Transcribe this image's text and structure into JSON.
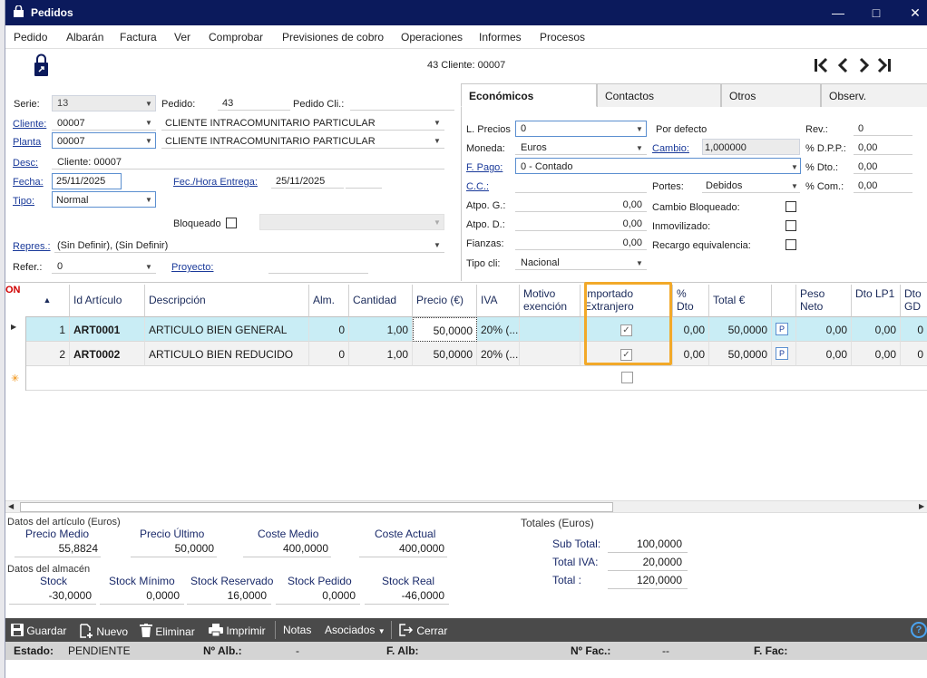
{
  "window": {
    "title": "Pedidos"
  },
  "menu": [
    "Pedido",
    "Albarán",
    "Factura",
    "Ver",
    "Comprobar",
    "Previsiones de cobro",
    "Operaciones",
    "Informes",
    "Procesos"
  ],
  "header": {
    "record_label": "43 Cliente: 00007"
  },
  "form": {
    "serie_label": "Serie:",
    "serie_value": "13",
    "pedido_label": "Pedido:",
    "pedido_value": "43",
    "pedido_cli_label": "Pedido Cli.:",
    "cliente_label": "Cliente:",
    "cliente_code": "00007",
    "cliente_name": "CLIENTE INTRACOMUNITARIO PARTICULAR",
    "planta_label": "Planta",
    "planta_code": "00007",
    "planta_name": "CLIENTE INTRACOMUNITARIO PARTICULAR",
    "desc_label": "Desc:",
    "desc_value": "Cliente: 00007",
    "fecha_label": "Fecha:",
    "fecha_value": "25/11/2025",
    "fec_entrega_label": "Fec./Hora Entrega:",
    "fec_entrega_value": "25/11/2025",
    "tipo_label": "Tipo:",
    "tipo_value": "Normal",
    "bloqueado_label": "Bloqueado",
    "repres_label": "Repres.:",
    "repres_value": "(Sin Definir), (Sin Definir)",
    "refer_label": "Refer.:",
    "refer_value": "0",
    "proyecto_label": "Proyecto:"
  },
  "tabs": [
    "Económicos",
    "Contactos",
    "Otros",
    "Observ."
  ],
  "econ": {
    "lprecios_label": "L. Precios",
    "lprecios_value": "0",
    "por_defecto": "Por defecto",
    "rev_label": "Rev.:",
    "rev_value": "0",
    "moneda_label": "Moneda:",
    "moneda_value": "Euros",
    "cambio_label": "Cambio:",
    "cambio_value": "1,000000",
    "dpp_label": "% D.P.P.:",
    "dpp_value": "0,00",
    "fpago_label": "F. Pago:",
    "fpago_value": "0 - Contado",
    "dto_label": "% Dto.:",
    "dto_value": "0,00",
    "cc_label": "C.C.:",
    "portes_label": "Portes:",
    "portes_value": "Debidos",
    "com_label": "% Com.:",
    "com_value": "0,00",
    "atpog_label": "Atpo. G.:",
    "atpog_value": "0,00",
    "cambio_bloq_label": "Cambio Bloqueado:",
    "atpod_label": "Atpo. D.:",
    "atpod_value": "0,00",
    "inmov_label": "Inmovilizado:",
    "fianzas_label": "Fianzas:",
    "fianzas_value": "0,00",
    "recargo_label": "Recargo equivalencia:",
    "tipocli_label": "Tipo cli:",
    "tipocli_value": "Nacional"
  },
  "grid": {
    "on_label": "ON",
    "columns": [
      "Id Artículo",
      "Descripción",
      "Alm.",
      "Cantidad",
      "Precio (€)",
      "IVA",
      "Motivo exención",
      "Importado Extranjero",
      "% Dto",
      "Total €",
      "Peso Neto",
      "Dto LP1",
      "Dto GD"
    ],
    "rows": [
      {
        "n": "1",
        "id": "ART0001",
        "desc": "ARTICULO BIEN GENERAL",
        "alm": "0",
        "cant": "1,00",
        "precio": "50,0000",
        "iva": "20% (...",
        "dto": "0,00",
        "total": "50,0000",
        "p": "P",
        "peso": "0,00",
        "lp1": "0,00",
        "gd": "0"
      },
      {
        "n": "2",
        "id": "ART0002",
        "desc": "ARTICULO BIEN REDUCIDO",
        "alm": "0",
        "cant": "1,00",
        "precio": "50,0000",
        "iva": "20% (...",
        "dto": "0,00",
        "total": "50,0000",
        "p": "P",
        "peso": "0,00",
        "lp1": "0,00",
        "gd": "0"
      }
    ]
  },
  "articulo": {
    "title": "Datos del artículo (Euros)",
    "precio_medio_label": "Precio Medio",
    "precio_medio": "55,8824",
    "precio_ultimo_label": "Precio Último",
    "precio_ultimo": "50,0000",
    "coste_medio_label": "Coste Medio",
    "coste_medio": "400,0000",
    "coste_actual_label": "Coste Actual",
    "coste_actual": "400,0000"
  },
  "almacen": {
    "title": "Datos del almacén",
    "stock_label": "Stock",
    "stock": "-30,0000",
    "stock_min_label": "Stock Mínimo",
    "stock_min": "0,0000",
    "stock_res_label": "Stock Reservado",
    "stock_res": "16,0000",
    "stock_ped_label": "Stock Pedido",
    "stock_ped": "0,0000",
    "stock_real_label": "Stock Real",
    "stock_real": "-46,0000"
  },
  "totales": {
    "title": "Totales (Euros)",
    "subtotal_label": "Sub Total:",
    "subtotal": "100,0000",
    "iva_label": "Total IVA:",
    "iva": "20,0000",
    "total_label": "Total :",
    "total": "120,0000"
  },
  "toolbar": {
    "guardar": "Guardar",
    "nuevo": "Nuevo",
    "eliminar": "Eliminar",
    "imprimir": "Imprimir",
    "notas": "Notas",
    "asociados": "Asociados",
    "cerrar": "Cerrar"
  },
  "status": {
    "estado_label": "Estado:",
    "estado_value": "PENDIENTE",
    "nalb_label": "Nº Alb.:",
    "nalb_value": "-",
    "falb_label": "F. Alb:",
    "nfac_label": "Nº Fac.:",
    "nfac_value": "--",
    "ffac_label": "F. Fac:"
  }
}
